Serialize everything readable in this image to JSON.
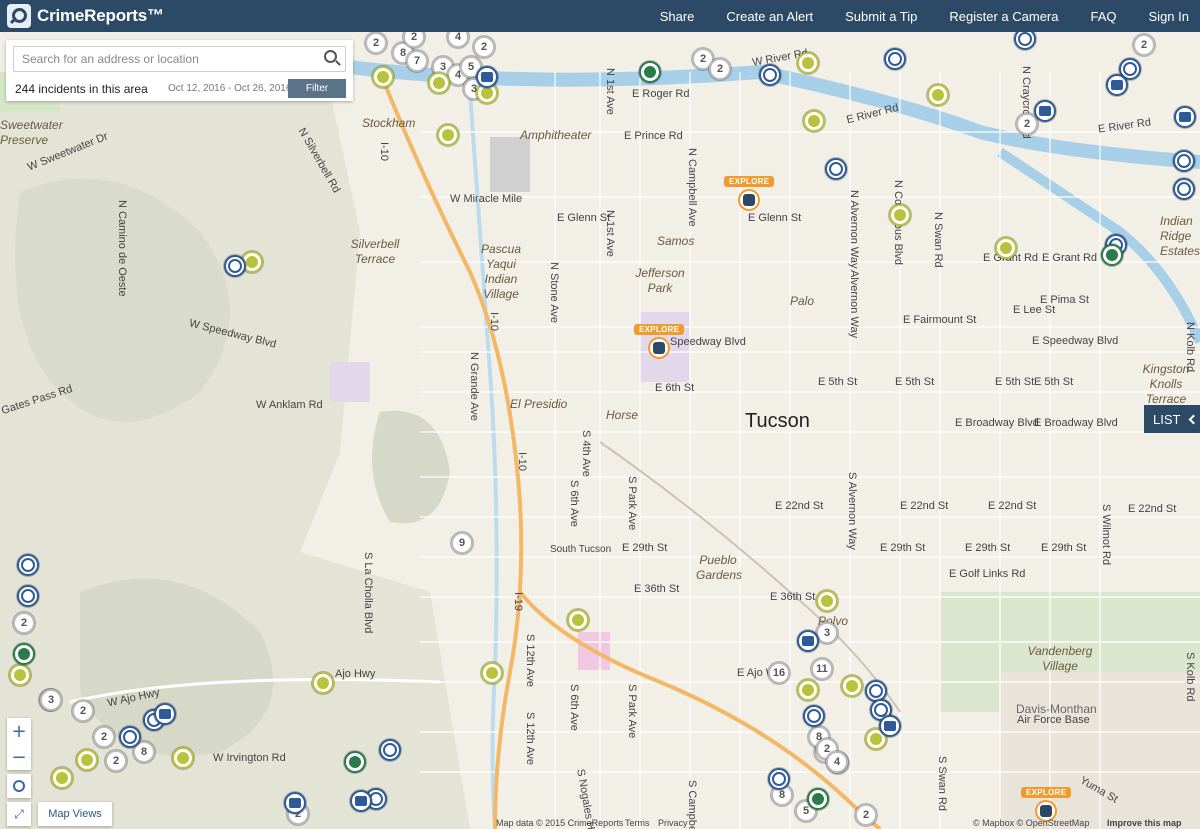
{
  "header": {
    "logo_text": "CrimeReports™",
    "nav": [
      "Share",
      "Create an Alert",
      "Submit a Tip",
      "Register a Camera",
      "FAQ",
      "Sign In"
    ]
  },
  "search": {
    "placeholder": "Search for an address or location",
    "incidents": "244 incidents in this area",
    "dates": "Oct 12, 2016 - Oct 26, 2016",
    "filter_label": "Filter"
  },
  "list_label": "LIST",
  "map_views_label": "Map Views",
  "attribution": {
    "left": "Map data © 2015 CrimeReports",
    "terms": "Terms",
    "privacy": "Privacy",
    "right": "© Mapbox © OpenStreetMap",
    "improve": "Improve this map"
  },
  "colors": {
    "header": "#2c4a66",
    "marker_yellow": "#b9c23c",
    "marker_blue": "#2f5a9a",
    "marker_green": "#2b7a4b",
    "explore": "#f19a2d"
  },
  "explore_label": "EXPLORE",
  "city": "Tucson",
  "neighborhoods": [
    "Stockham",
    "Amphitheater",
    "Samos",
    "Silverbell Terrace",
    "Pascua Yaqui Indian Village",
    "Jefferson Park",
    "Palo",
    "El Presidio",
    "Horse",
    "Pueblo Gardens",
    "Polvo",
    "Vandenberg Village",
    "Kingston Knolls Terrace",
    "Indian Ridge Estates",
    "Sweetwater Preserve"
  ],
  "streets_h": [
    "E Roger Rd",
    "E Prince Rd",
    "E River Rd",
    "W Sweetwater Dr",
    "W Miracle Mile",
    "E Glenn St",
    "E Glenn St",
    "E Grant Rd",
    "E Grant Rd",
    "E Pima St",
    "E Lee St",
    "E Fairmount St",
    "W Speedway Blvd",
    "Speedway Blvd",
    "E Speedway Blvd",
    "E 6th St",
    "E 5th St",
    "E 5th St",
    "E 5th St",
    "E 5th St",
    "W Anklam Rd",
    "E Broadway Blvd",
    "E Broadway Blvd",
    "E 22nd St",
    "E 22nd St",
    "E 22nd St",
    "E 22nd St",
    "E 29th St",
    "E 29th St",
    "E 29th St",
    "E 29th St",
    "South Tucson",
    "E Golf Links Rd",
    "E 36th St",
    "E 36th St",
    "E Ajo Way",
    "W Ajo Hwy",
    "Ajo Hwy",
    "W Irvington Rd",
    "Air Force Base",
    "Yuma St",
    "Gates Pass Rd",
    "W River Rd",
    "E River Rd"
  ],
  "streets_v": [
    "N 1st Ave",
    "N 1st Ave",
    "N Campbell Ave",
    "N Alvernon Way",
    "Alvernon Way",
    "N Columbus Blvd",
    "N Swan Rd",
    "N Craycroft Rd",
    "N Stone Ave",
    "N Grande Ave",
    "I-10",
    "I-10",
    "I-10",
    "I-19",
    "S 4th Ave",
    "S 6th Ave",
    "S Park Ave",
    "S Alvernon Way",
    "S La Cholla Blvd",
    "S 12th Ave",
    "S 12th Ave",
    "S 6th Ave",
    "S Park Ave",
    "S Campbell Ave",
    "S Nogales Hwy",
    "S Swan Rd",
    "S Wilmot Rd",
    "S Kolb Rd",
    "N Kolb Rd",
    "N Camino de Oeste",
    "N Silverbell Rd"
  ],
  "davis_monthan": "Davis-Monthan",
  "counts": [
    "2",
    "8",
    "2",
    "4",
    "7",
    "3",
    "4",
    "5",
    "3",
    "2",
    "2",
    "2",
    "2",
    "2",
    "9",
    "2",
    "3",
    "2",
    "2",
    "8",
    "2",
    "3",
    "4",
    "2",
    "16",
    "11",
    "3",
    "8",
    "2",
    "4",
    "8",
    "5",
    "3",
    "2"
  ]
}
